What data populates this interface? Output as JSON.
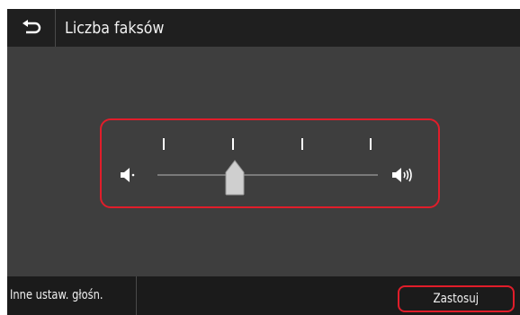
{
  "header": {
    "back_icon": "return-arrow-icon",
    "title": "Liczba faksów"
  },
  "slider": {
    "min_icon": "speaker-low-icon",
    "max_icon": "speaker-high-icon",
    "tick_count": 4,
    "level_fraction": 0.35,
    "highlight_color": "#e11d2a"
  },
  "footer": {
    "other_settings_label": "Inne ustaw. głośn.",
    "apply_label": "Zastosuj"
  }
}
